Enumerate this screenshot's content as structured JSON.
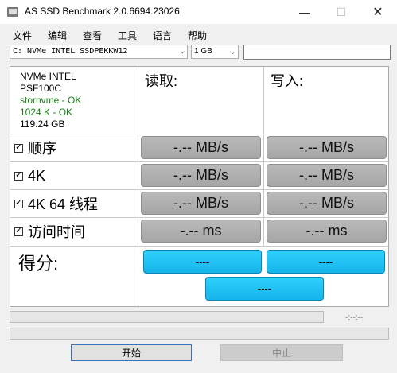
{
  "window": {
    "title": "AS SSD Benchmark 2.0.6694.23026",
    "min_glyph": "—",
    "max_glyph": "☐",
    "close_glyph": "✕"
  },
  "menu": [
    "文件",
    "编辑",
    "查看",
    "工具",
    "语言",
    "帮助"
  ],
  "drive_select": {
    "value": "C: NVMe INTEL SSDPEKKW12",
    "arrow": "⌵"
  },
  "size_select": {
    "value": "1 GB",
    "arrow": "⌵"
  },
  "device_info": {
    "model": "NVMe INTEL",
    "firmware": "PSF100C",
    "driver": "stornvme - OK",
    "alignment": "1024 K - OK",
    "capacity": "119.24 GB"
  },
  "columns": {
    "read": "读取:",
    "write": "写入:"
  },
  "tests": [
    {
      "label": "顺序",
      "checked": true,
      "read": "-.-- MB/s",
      "write": "-.-- MB/s"
    },
    {
      "label": "4K",
      "checked": true,
      "read": "-.-- MB/s",
      "write": "-.-- MB/s"
    },
    {
      "label": "4K 64 线程",
      "checked": true,
      "read": "-.-- MB/s",
      "write": "-.-- MB/s"
    },
    {
      "label": "访问时间",
      "checked": true,
      "read": "-.-- ms",
      "write": "-.-- ms"
    }
  ],
  "score": {
    "label": "得分:",
    "read": "----",
    "write": "----",
    "total": "----"
  },
  "progress": {
    "time": "-:--:--"
  },
  "buttons": {
    "start": "开始",
    "abort": "中止"
  },
  "colors": {
    "score_accent": "#1fc0f2",
    "ok_text": "#1a7f1a"
  }
}
